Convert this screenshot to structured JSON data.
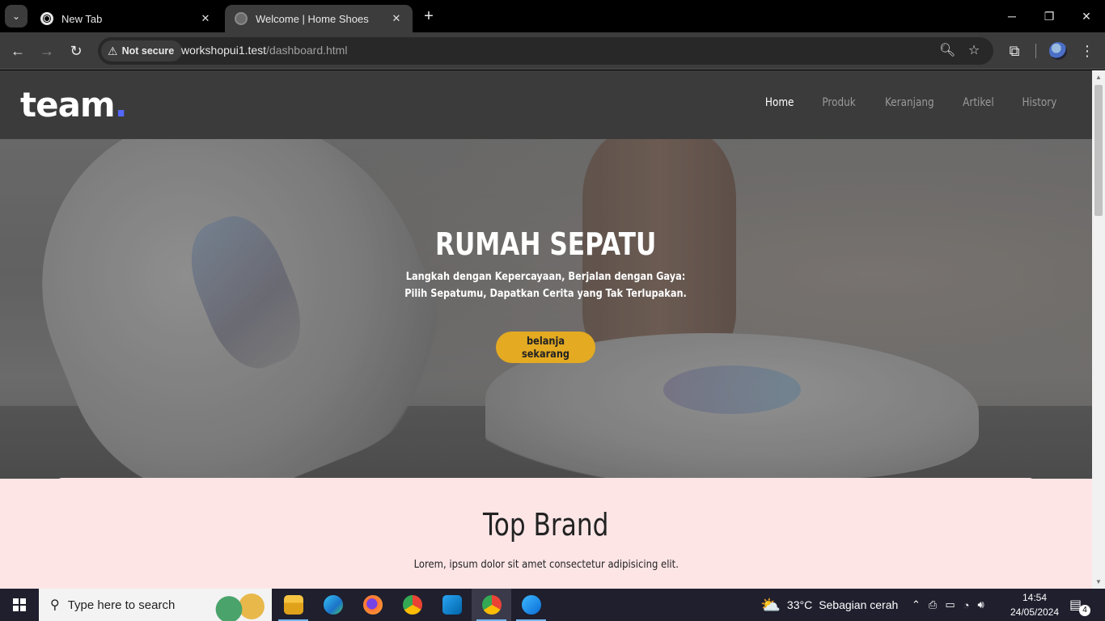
{
  "browser": {
    "tabs": [
      {
        "label": "New Tab"
      },
      {
        "label": "Welcome | Home Shoes"
      }
    ],
    "security_label": "Not secure",
    "url_host": "workshopui1.test",
    "url_path": "/dashboard.html"
  },
  "site": {
    "logo": "team",
    "logo_dot": ".",
    "nav": [
      "Home",
      "Produk",
      "Keranjang",
      "Artikel",
      "History"
    ],
    "hero": {
      "title": "RUMAH SEPATU",
      "subtitle_line1": "Langkah dengan Kepercayaan, Berjalan dengan Gaya:",
      "subtitle_line2": "Pilih Sepatumu, Dapatkan Cerita yang Tak Terlupakan.",
      "cta": "belanja sekarang"
    },
    "brand_section": {
      "title": "Top Brand",
      "description": "Lorem, ipsum dolor sit amet consectetur adipisicing elit."
    }
  },
  "taskbar": {
    "search_placeholder": "Type here to search",
    "weather_temp": "33°C",
    "weather_text": "Sebagian cerah",
    "time": "14:54",
    "date": "24/05/2024",
    "notification_count": "4"
  },
  "colors": {
    "accent_button": "#e3aa22",
    "logo_dot": "#5468ff",
    "nav_bg": "#3b3b3b",
    "section_bg": "#fde5e6"
  }
}
